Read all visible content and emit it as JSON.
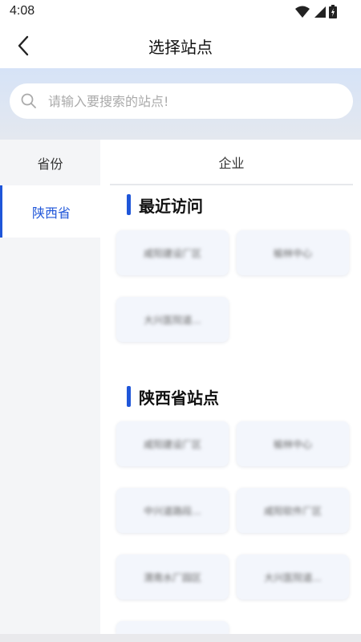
{
  "status_bar": {
    "time": "4:08"
  },
  "header": {
    "title": "选择站点"
  },
  "search": {
    "placeholder": "请输入要搜索的站点!"
  },
  "left_panel": {
    "header": "省份",
    "provinces": [
      {
        "label": "陕西省",
        "selected": true
      }
    ]
  },
  "right_panel": {
    "header": "企业",
    "recent": {
      "title": "最近访问",
      "items": [
        "咸阳建设厂区",
        "榆林中心",
        "大兴医院道..."
      ]
    },
    "province_sites": {
      "title": "陕西省站点",
      "items": [
        "咸阳建设厂区",
        "榆林中心",
        "中兴道路段...",
        "咸阳软件厂区",
        "渭南水厂园区",
        "大兴医院道...",
        ""
      ]
    }
  },
  "colors": {
    "accent": "#1f56d9",
    "card_bg": "#f3f6fc",
    "side_bg": "#f4f5f7"
  }
}
